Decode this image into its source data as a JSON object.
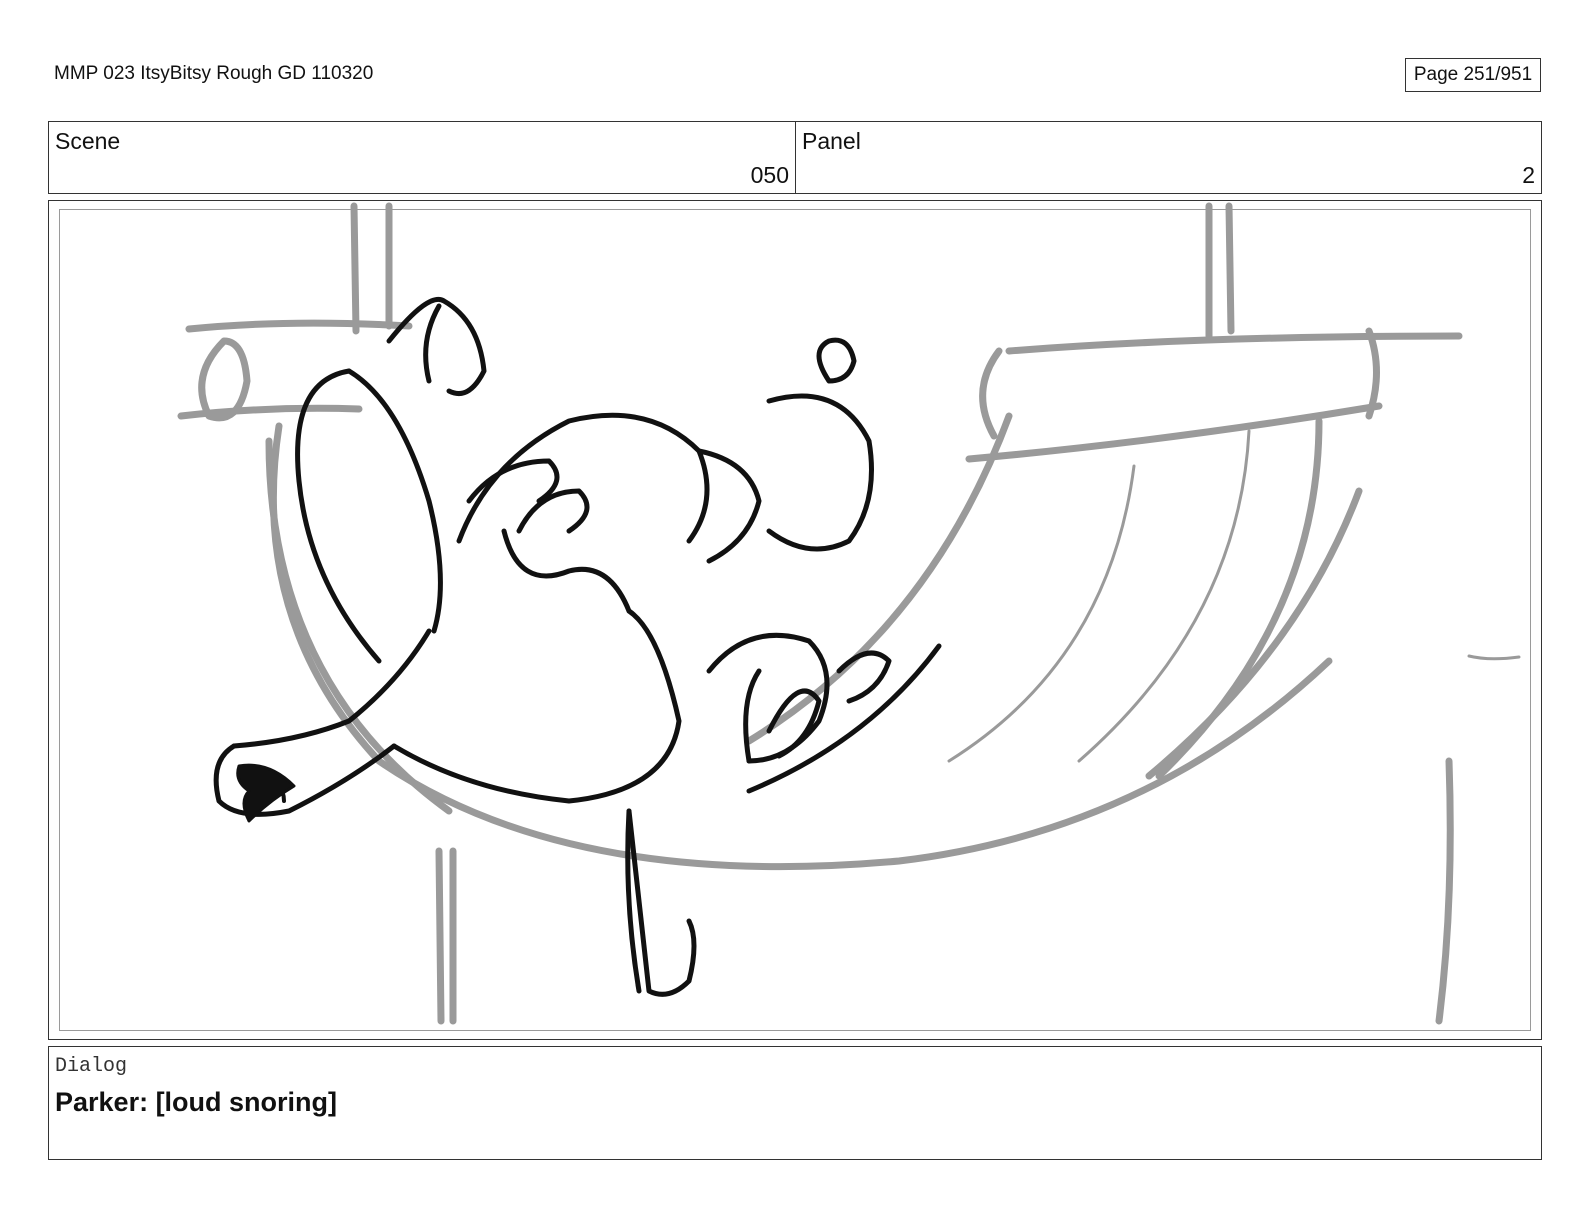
{
  "document": {
    "title": "MMP 023 ItsyBitsy Rough GD 110320",
    "page": "Page 251/951"
  },
  "header": {
    "scene_label": "Scene",
    "scene_value": "050",
    "panel_label": "Panel",
    "panel_value": "2"
  },
  "artwork": {
    "subject": "sketch-icon",
    "colors": {
      "ink": "#111111",
      "rough": "#9a9a9a"
    }
  },
  "dialog": {
    "label": "Dialog",
    "text": "Parker: [loud snoring]"
  }
}
